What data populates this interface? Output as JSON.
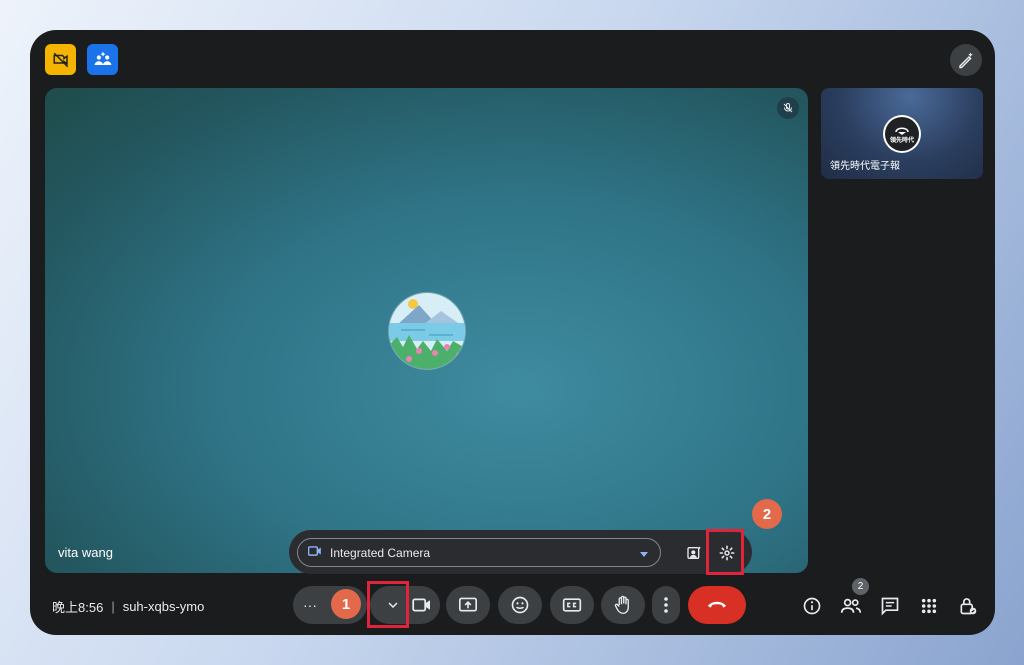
{
  "meeting": {
    "time": "晚上8:56",
    "separator": "|",
    "code": "suh-xqbs-ymo"
  },
  "participants": {
    "main_name": "vita wang",
    "side_name": "領先時代電子報",
    "side_avatar_text": "領先時代",
    "count": "2"
  },
  "camera_popover": {
    "selected_device": "Integrated Camera"
  },
  "controls": {
    "more_label": "···"
  },
  "annotations": {
    "step1": "1",
    "step2": "2"
  },
  "colors": {
    "end_call": "#d93025",
    "annotation_box": "#e0243a",
    "annotation_badge": "#e2694a",
    "accent_blue": "#1a73e8",
    "accent_yellow": "#f4b400"
  },
  "icons": [
    "camera-off-icon",
    "people-sparkle-icon",
    "magic-pen-icon",
    "mic-off-icon",
    "video-icon",
    "caret-down-icon",
    "portrait-effects-icon",
    "gear-icon",
    "chevron-down-icon",
    "video-camera-icon",
    "present-screen-icon",
    "emoji-icon",
    "captions-icon",
    "raise-hand-icon",
    "more-vert-icon",
    "end-call-icon",
    "info-icon",
    "people-icon",
    "chat-icon",
    "apps-icon",
    "host-lock-icon"
  ]
}
